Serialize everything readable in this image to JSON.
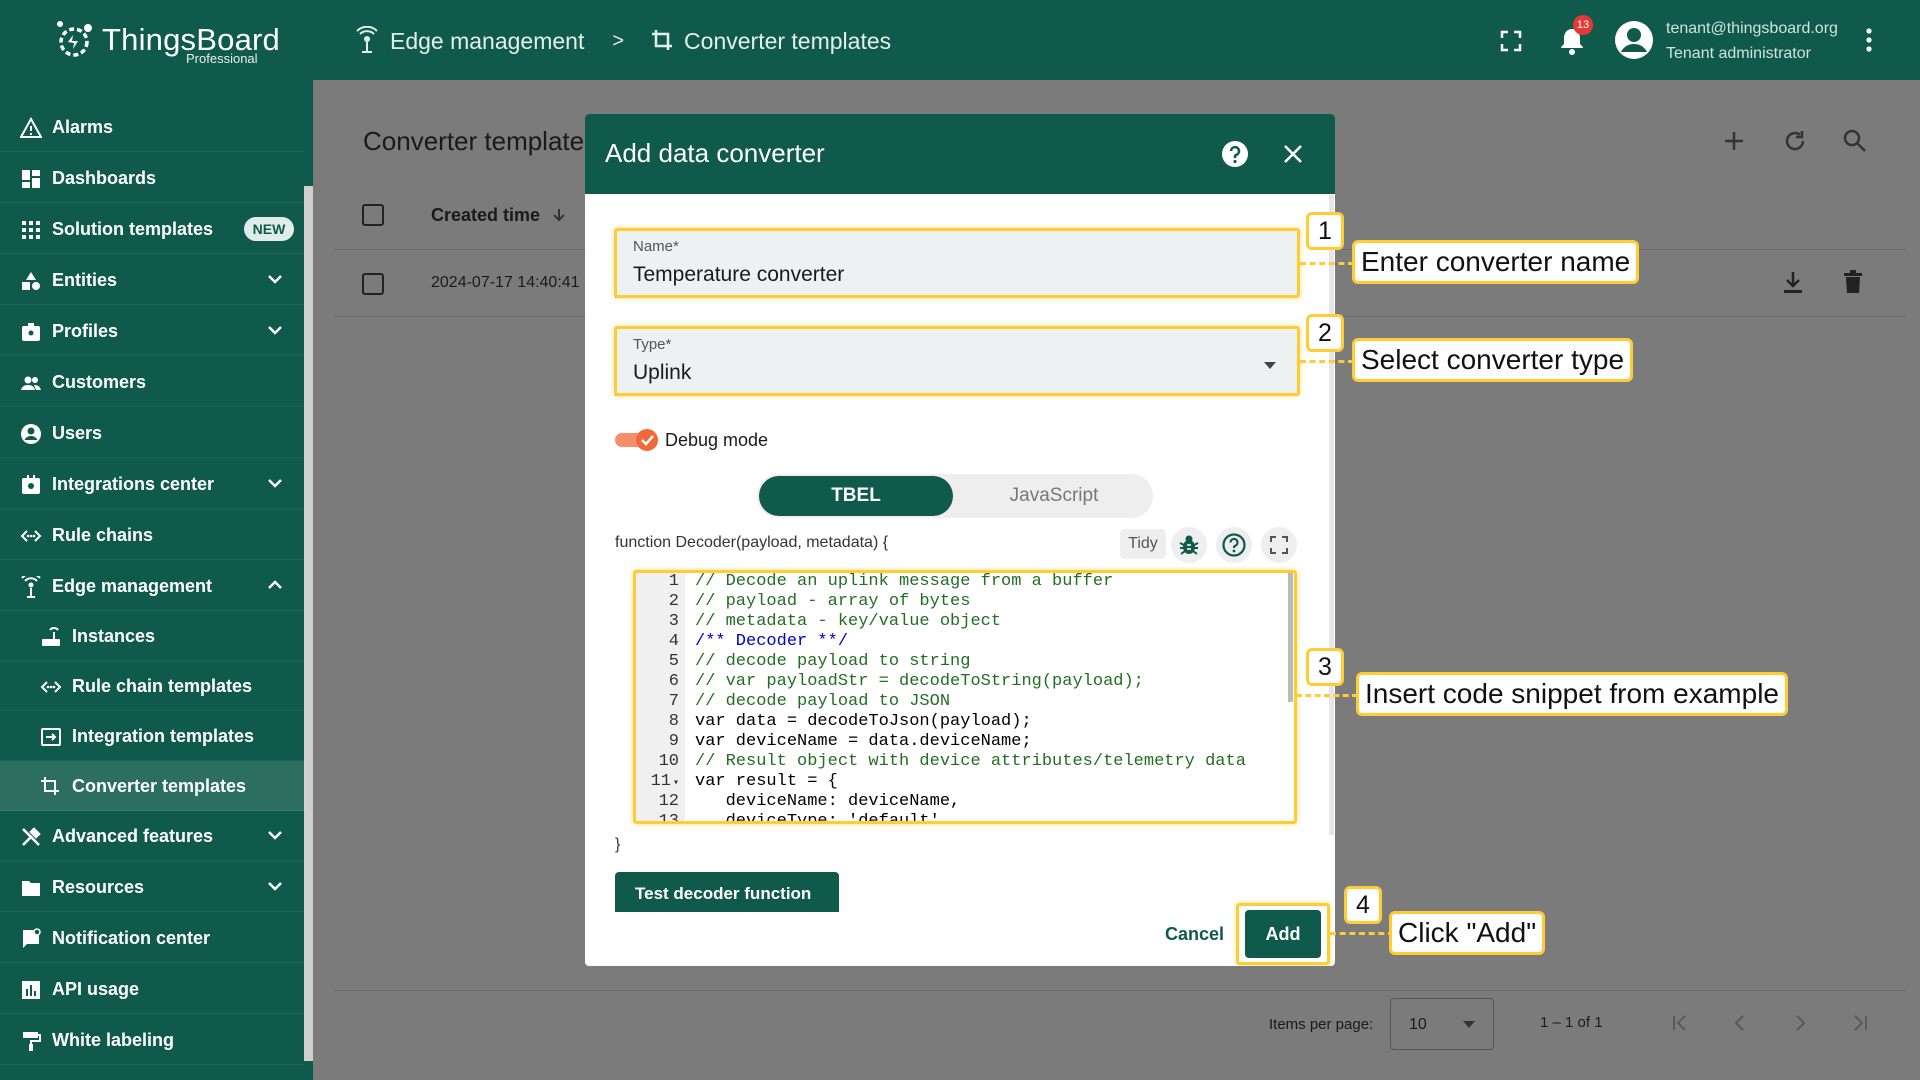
{
  "app": {
    "brand": "ThingsBoard",
    "edition": "Professional"
  },
  "topbar": {
    "crumb1": "Edge management",
    "separator": ">",
    "crumb2": "Converter templates",
    "notif_count": "13",
    "user_email": "tenant@thingsboard.org",
    "user_role": "Tenant administrator"
  },
  "sidebar": {
    "items": [
      {
        "label": "Alarms",
        "icon": "warning-icon"
      },
      {
        "label": "Dashboards",
        "icon": "dashboard-icon"
      },
      {
        "label": "Solution templates",
        "icon": "apps-icon",
        "badge": "NEW"
      },
      {
        "label": "Entities",
        "icon": "entities-icon"
      },
      {
        "label": "Profiles",
        "icon": "profiles-icon"
      },
      {
        "label": "Customers",
        "icon": "customers-icon"
      },
      {
        "label": "Users",
        "icon": "user-icon"
      },
      {
        "label": "Integrations center",
        "icon": "integrations-icon"
      },
      {
        "label": "Rule chains",
        "icon": "rule-chain-icon"
      },
      {
        "label": "Edge management",
        "icon": "edge-icon"
      },
      {
        "label": "Instances",
        "icon": "router-icon"
      },
      {
        "label": "Rule chain templates",
        "icon": "rule-chain-icon"
      },
      {
        "label": "Integration templates",
        "icon": "input-icon"
      },
      {
        "label": "Converter templates",
        "icon": "transform-icon"
      },
      {
        "label": "Advanced features",
        "icon": "tools-icon"
      },
      {
        "label": "Resources",
        "icon": "folder-icon"
      },
      {
        "label": "Notification center",
        "icon": "notification-icon"
      },
      {
        "label": "API usage",
        "icon": "chart-icon"
      },
      {
        "label": "White labeling",
        "icon": "format-paint-icon"
      }
    ]
  },
  "page": {
    "title": "Converter templates",
    "col_created": "Created time",
    "row_date": "2024-07-17 14:40:41",
    "items_per_page_label": "Items per page:",
    "items_per_page": "10",
    "range": "1 – 1 of 1"
  },
  "dialog": {
    "title": "Add data converter",
    "name_label": "Name*",
    "name_value": "Temperature converter",
    "type_label": "Type*",
    "type_value": "Uplink",
    "debug_label": "Debug mode",
    "tab_tbel": "TBEL",
    "tab_js": "JavaScript",
    "fn_signature": "function Decoder(payload, metadata) {",
    "tidy": "Tidy",
    "code_lines": [
      "// Decode an uplink message from a buffer",
      "// payload - array of bytes",
      "// metadata - key/value object",
      "/** Decoder **/",
      "// decode payload to string",
      "// var payloadStr = decodeToString(payload);",
      "// decode payload to JSON",
      "var data = decodeToJson(payload);",
      "var deviceName = data.deviceName;",
      "// Result object with device attributes/telemetry data",
      "var result = {",
      "   deviceName: deviceName,",
      "   deviceType: 'default',"
    ],
    "close_brace": "}",
    "test_button": "Test decoder function",
    "cancel": "Cancel",
    "add": "Add"
  },
  "callouts": [
    {
      "num": "1",
      "text": "Enter converter name"
    },
    {
      "num": "2",
      "text": "Select converter type"
    },
    {
      "num": "3",
      "text": "Insert code snippet from example"
    },
    {
      "num": "4",
      "text": "Click \"Add\""
    }
  ],
  "colors": {
    "brand": "#0f5a4b",
    "highlight": "#ffcc33",
    "toggle": "#f2683a",
    "alert": "#e53935"
  }
}
